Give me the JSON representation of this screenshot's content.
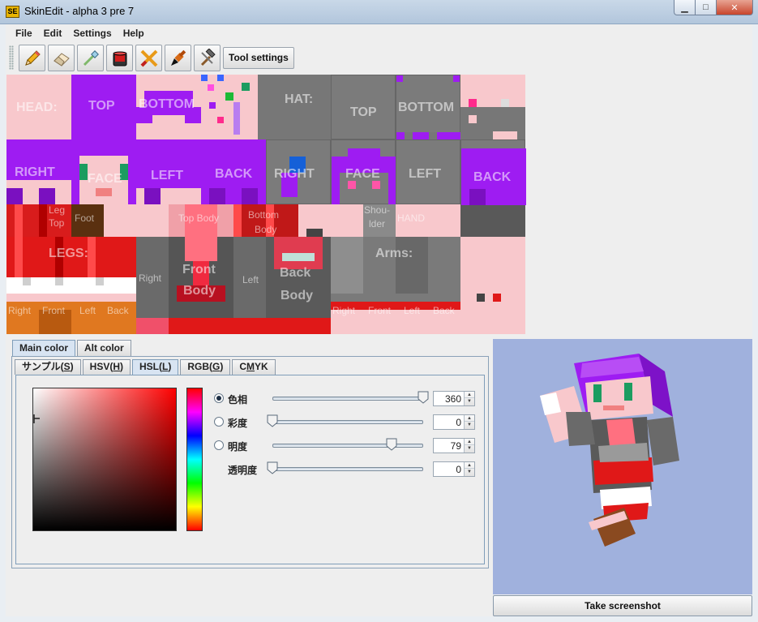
{
  "window": {
    "app_icon_text": "SE",
    "title": "SkinEdit - alpha 3 pre 7",
    "min_glyph": "▁",
    "max_glyph": "□",
    "close_glyph": "✕"
  },
  "menu": [
    "File",
    "Edit",
    "Settings",
    "Help"
  ],
  "toolbar": {
    "tools": [
      "pencil-icon",
      "eraser-icon",
      "eyedropper-icon",
      "paint-bucket-icon",
      "pencil-ruler-icon",
      "brush-icon",
      "hammer-wrench-icon"
    ],
    "settings_label": "Tool settings"
  },
  "skin_labels": {
    "head": "HEAD:",
    "top": "TOP",
    "bottom": "BOTTOM",
    "hat": "HAT:",
    "hat_top": "TOP",
    "hat_bottom": "BOTTOM",
    "right": "RIGHT",
    "face": "FACE",
    "left": "LEFT",
    "back": "BACK",
    "hat_right": "RIGHT",
    "hat_face": "FACE",
    "hat_left": "LEFT",
    "hat_back": "BACK",
    "leg_top_1": "Leg",
    "leg_top_2": "Top",
    "foot": "Foot",
    "top_body": "Top Body",
    "bottom_body_1": "Bottom",
    "bottom_body_2": "Body",
    "shoulder_1": "Shou-",
    "shoulder_2": "lder",
    "hand": "HAND",
    "legs": "LEGS:",
    "front_body_1": "Front",
    "front_body_2": "Body",
    "back_body_1": "Back",
    "back_body_2": "Body",
    "body_right": "Right",
    "body_left": "Left",
    "arms": "Arms:",
    "leg_right": "Right",
    "leg_front": "Front",
    "leg_left": "Left",
    "leg_back": "Back",
    "arm_right": "Right",
    "arm_front": "Front",
    "arm_left": "Left",
    "arm_back": "Back"
  },
  "color_tabs": [
    "Main color",
    "Alt color"
  ],
  "mode_tabs": [
    {
      "pre": "サンプル(",
      "key": "S",
      "post": ")"
    },
    {
      "pre": "HSV(",
      "key": "H",
      "post": ")"
    },
    {
      "pre": "HSL(",
      "key": "L",
      "post": ")"
    },
    {
      "pre": "RGB(",
      "key": "G",
      "post": ")"
    },
    {
      "pre": "C",
      "key": "M",
      "post": "YK"
    }
  ],
  "active_mode": "HSL",
  "sliders": [
    {
      "label": "色相",
      "value": "360",
      "fraction": 1.0,
      "radio": true,
      "checked": true
    },
    {
      "label": "彩度",
      "value": "0",
      "fraction": 0.0,
      "radio": true,
      "checked": false
    },
    {
      "label": "明度",
      "value": "79",
      "fraction": 0.79,
      "radio": true,
      "checked": false
    },
    {
      "label": "透明度",
      "value": "0",
      "fraction": 0.0,
      "radio": false,
      "checked": false
    }
  ],
  "preview": {
    "button_label": "Take screenshot"
  },
  "colors": {
    "purple": "#9e1cf2",
    "pink": "#f8c8cc",
    "red": "#e01818",
    "gray": "#777777",
    "dark": "#595959"
  }
}
